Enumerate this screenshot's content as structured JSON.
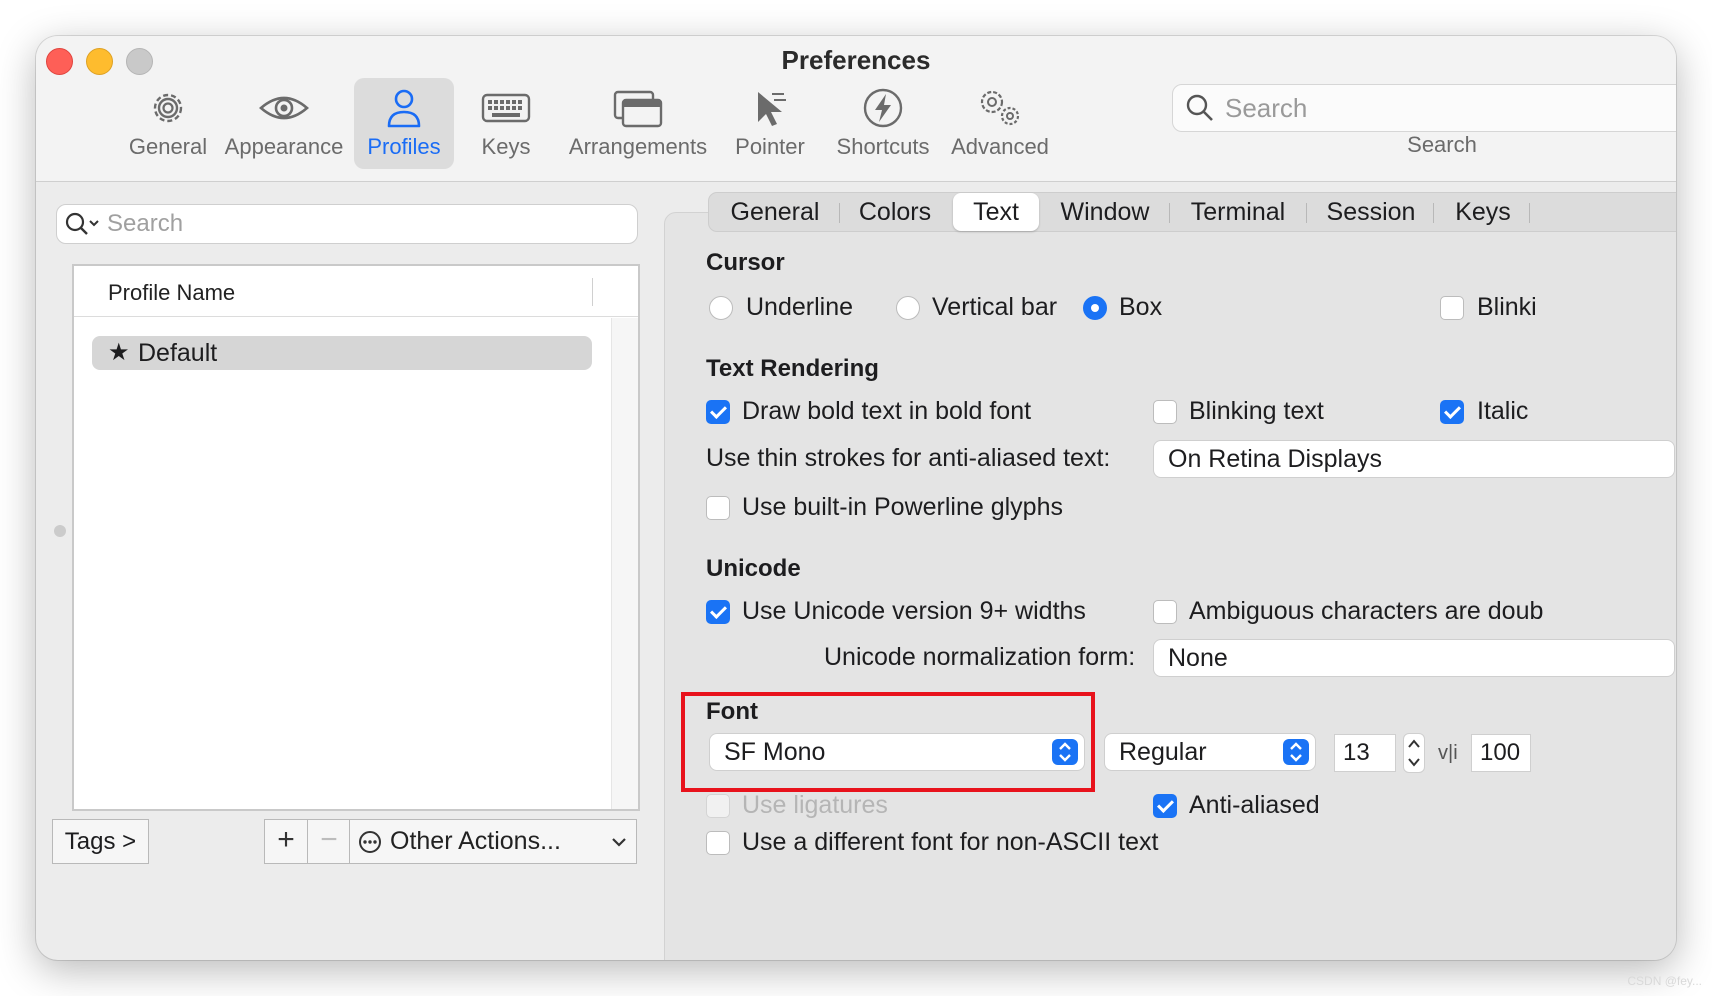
{
  "window": {
    "title": "Preferences"
  },
  "toolbar": {
    "items": [
      {
        "label": "General",
        "icon": "gear-icon"
      },
      {
        "label": "Appearance",
        "icon": "eye-icon"
      },
      {
        "label": "Profiles",
        "icon": "person-icon",
        "active": true
      },
      {
        "label": "Keys",
        "icon": "keyboard-icon"
      },
      {
        "label": "Arrangements",
        "icon": "windows-icon"
      },
      {
        "label": "Pointer",
        "icon": "pointer-icon"
      },
      {
        "label": "Shortcuts",
        "icon": "bolt-icon"
      },
      {
        "label": "Advanced",
        "icon": "gears-icon"
      }
    ],
    "search_placeholder": "Search",
    "search_caption": "Search"
  },
  "profiles": {
    "search_placeholder": "Search",
    "column_header": "Profile Name",
    "rows": [
      {
        "name": "Default",
        "icon": "star-icon",
        "selected": true
      }
    ],
    "tags_button": "Tags >",
    "add_button": "+",
    "remove_button": "−",
    "other_actions": "Other Actions..."
  },
  "tabs": {
    "items": [
      "General",
      "Colors",
      "Text",
      "Window",
      "Terminal",
      "Session",
      "Keys"
    ],
    "active": "Text"
  },
  "cursor": {
    "heading": "Cursor",
    "options": [
      "Underline",
      "Vertical bar",
      "Box"
    ],
    "selected": "Box",
    "blinking_label": "Blinki",
    "blinking_checked": false
  },
  "text_rendering": {
    "heading": "Text Rendering",
    "bold_label": "Draw bold text in bold font",
    "bold_checked": true,
    "blinking_text_label": "Blinking text",
    "blinking_text_checked": false,
    "italic_label": "Italic",
    "italic_checked": true,
    "thin_strokes_label": "Use thin strokes for anti-aliased text:",
    "thin_strokes_value": "On Retina Displays",
    "powerline_label": "Use built-in Powerline glyphs",
    "powerline_checked": false
  },
  "unicode": {
    "heading": "Unicode",
    "widths_label": "Use Unicode version 9+ widths",
    "widths_checked": true,
    "ambiguous_label": "Ambiguous characters are doub",
    "ambiguous_checked": false,
    "normalization_label": "Unicode normalization form:",
    "normalization_value": "None"
  },
  "font": {
    "heading": "Font",
    "family": "SF Mono",
    "style": "Regular",
    "size": "13",
    "spacing_symbol": "v|i",
    "spacing_value": "100",
    "ligatures_label": "Use ligatures",
    "ligatures_enabled": false,
    "antialiased_label": "Anti-aliased",
    "antialiased_checked": true,
    "non_ascii_label": "Use a different font for non-ASCII text",
    "non_ascii_checked": false
  },
  "colors": {
    "accent": "#1a73f5",
    "highlight_box": "#e8121c",
    "close": "#fe5f57",
    "minimize": "#febc2e"
  },
  "watermark": "CSDN @fey..."
}
